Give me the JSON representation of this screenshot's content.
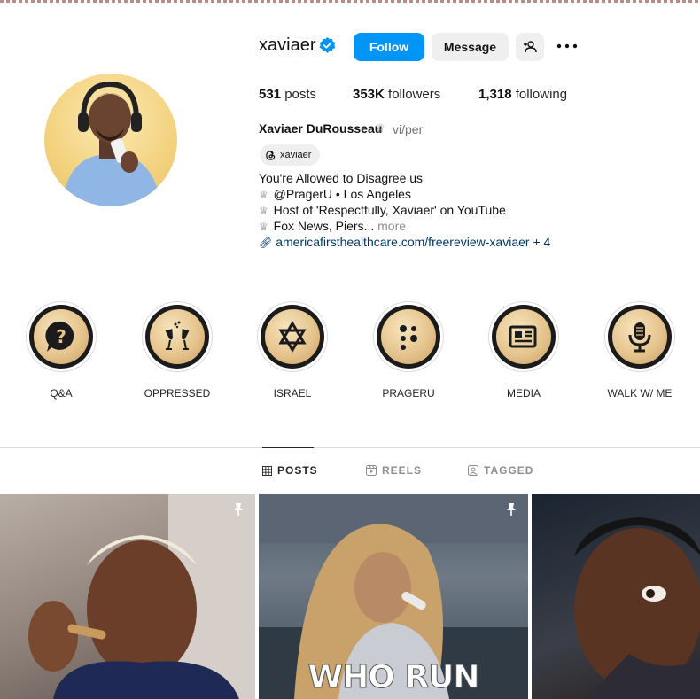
{
  "profile": {
    "username": "xaviaer",
    "verified": true,
    "follow_label": "Follow",
    "message_label": "Message",
    "stats": {
      "posts_count": "531",
      "posts_label": "posts",
      "followers_count": "353K",
      "followers_label": "followers",
      "following_count": "1,318",
      "following_label": "following"
    },
    "full_name": "Xaviaer DuRousseau",
    "pronouns": "vi/per",
    "threads_handle": "xaviaer",
    "bio_lines": [
      "You're Allowed to Disagree us",
      "@PragerU • Los Angeles",
      "Host of 'Respectfully, Xaviaer' on YouTube",
      "Fox News, Piers..."
    ],
    "bio_more": "more",
    "link": "americafirsthealthcare.com/freereview-xaviaer + 4"
  },
  "highlights": [
    {
      "label": "Q&A",
      "icon": "question-bubble-icon"
    },
    {
      "label": "OPPRESSED",
      "icon": "champagne-icon"
    },
    {
      "label": "ISRAEL",
      "icon": "star-of-david-icon"
    },
    {
      "label": "PRAGERU",
      "icon": "dots-icon"
    },
    {
      "label": "MEDIA",
      "icon": "newspaper-icon"
    },
    {
      "label": "WALK W/ ME",
      "icon": "microphone-icon"
    }
  ],
  "tabs": [
    {
      "label": "POSTS",
      "active": true,
      "icon": "grid-icon"
    },
    {
      "label": "REELS",
      "active": false,
      "icon": "reels-icon"
    },
    {
      "label": "TAGGED",
      "active": false,
      "icon": "tagged-icon"
    }
  ],
  "posts": [
    {
      "pinned": true,
      "overlay": ""
    },
    {
      "pinned": true,
      "overlay": "WHO RUN"
    },
    {
      "pinned": false,
      "overlay": ""
    }
  ],
  "colors": {
    "follow_button": "#0095f6",
    "verified_badge": "#0095f6",
    "link": "#00376b"
  }
}
